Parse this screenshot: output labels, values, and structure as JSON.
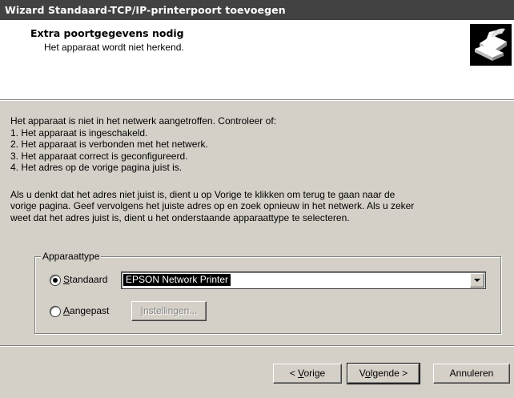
{
  "window": {
    "title": "Wizard Standaard-TCP/IP-printerpoort toevoegen"
  },
  "header": {
    "title": "Extra poortgegevens nodig",
    "subtitle": "Het apparaat wordt niet herkend.",
    "icon": "printer-wizard-icon"
  },
  "body": {
    "intro": "Het apparaat is niet in het netwerk aangetroffen. Controleer of:",
    "checklist": [
      "1. Het apparaat is ingeschakeld.",
      "2. Het apparaat is verbonden met het netwerk.",
      "3. Het apparaat correct is geconfigureerd.",
      "4. Het adres op de vorige pagina juist is."
    ],
    "paragraph_lines": [
      "Als u denkt dat het adres niet juist is, dient u op Vorige te klikken om terug te gaan naar de",
      "vorige pagina. Geef vervolgens het juiste adres op en zoek opnieuw in het netwerk. Als u zeker",
      "weet dat het adres juist is, dient u het onderstaande apparaattype te selecteren."
    ]
  },
  "device_type": {
    "legend": "Apparaattype",
    "standard": {
      "label_ul": "S",
      "label_rest": "tandaard",
      "selected": true
    },
    "select_value": "EPSON Network Printer",
    "custom": {
      "label_ul": "A",
      "label_rest": "angepast",
      "selected": false
    },
    "settings_button": {
      "label_ul": "I",
      "label_rest": "nstellingen..."
    }
  },
  "footer": {
    "back": {
      "pre": "< ",
      "ul": "V",
      "rest": "orige"
    },
    "next": {
      "pre": "V",
      "ul": "o",
      "rest": "lgende >"
    },
    "cancel": "Annuleren"
  }
}
